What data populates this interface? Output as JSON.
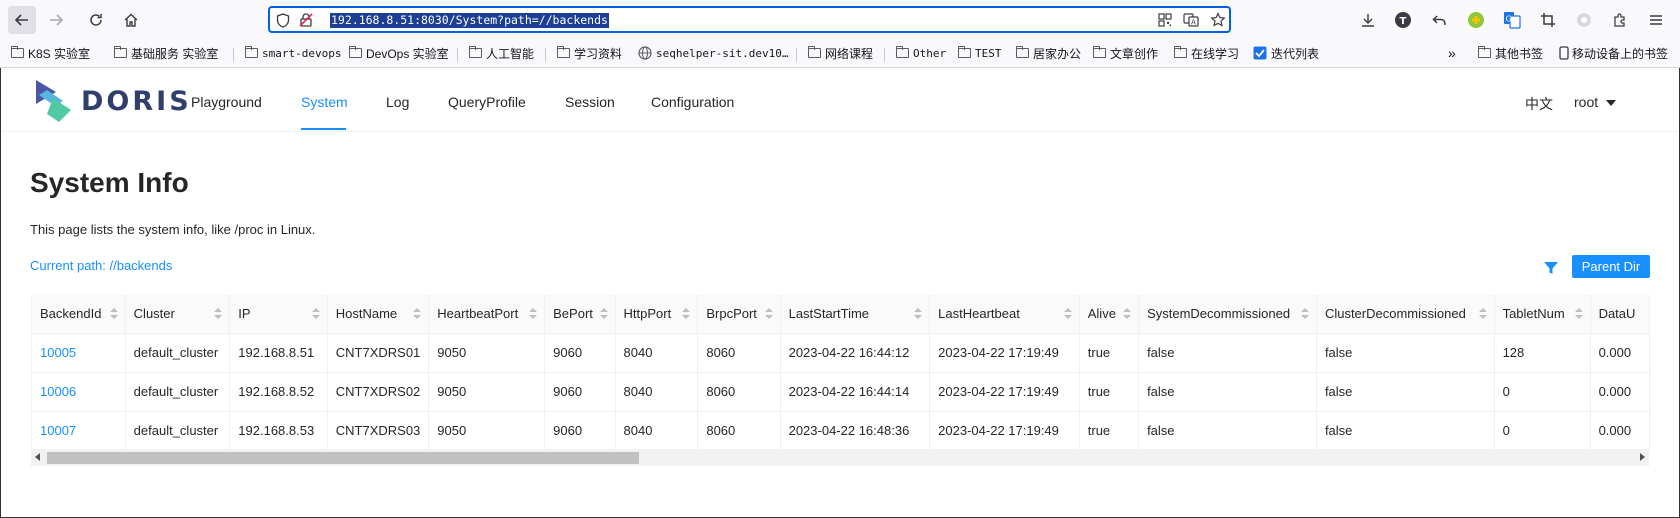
{
  "browser": {
    "url": "192.168.8.51:8030/System?path=//backends",
    "bookmarks": [
      "K8S 实验室",
      "基础服务 实验室",
      "smart-devops",
      "DevOps 实验室",
      "人工智能",
      "学习资料",
      "seqhelper-sit.dev10…",
      "网络课程",
      "Other",
      "TEST",
      "居家办公",
      "文章创作",
      "在线学习",
      "迭代列表"
    ],
    "other_bookmarks": "其他书签",
    "mobile_bookmarks": "移动设备上的书签"
  },
  "app": {
    "logo_text": "DORIS",
    "menu": [
      "Playground",
      "System",
      "Log",
      "QueryProfile",
      "Session",
      "Configuration"
    ],
    "active_menu": "System",
    "language": "中文",
    "user": "root"
  },
  "page": {
    "title": "System Info",
    "description": "This page lists the system info, like /proc in Linux.",
    "current_path": "Current path: //backends",
    "parent_dir_label": "Parent Dir"
  },
  "table": {
    "columns": [
      "BackendId",
      "Cluster",
      "IP",
      "HostName",
      "HeartbeatPort",
      "BePort",
      "HttpPort",
      "BrpcPort",
      "LastStartTime",
      "LastHeartbeat",
      "Alive",
      "SystemDecommissioned",
      "ClusterDecommissioned",
      "TabletNum",
      "DataU"
    ],
    "rows": [
      [
        "10005",
        "default_cluster",
        "192.168.8.51",
        "CNT7XDRS01",
        "9050",
        "9060",
        "8040",
        "8060",
        "2023-04-22 16:44:12",
        "2023-04-22 17:19:49",
        "true",
        "false",
        "false",
        "128",
        "0.000"
      ],
      [
        "10006",
        "default_cluster",
        "192.168.8.52",
        "CNT7XDRS02",
        "9050",
        "9060",
        "8040",
        "8060",
        "2023-04-22 16:44:14",
        "2023-04-22 17:19:49",
        "true",
        "false",
        "false",
        "0",
        "0.000"
      ],
      [
        "10007",
        "default_cluster",
        "192.168.8.53",
        "CNT7XDRS03",
        "9050",
        "9060",
        "8040",
        "8060",
        "2023-04-22 16:48:36",
        "2023-04-22 17:19:49",
        "true",
        "false",
        "false",
        "0",
        "0.000"
      ]
    ]
  },
  "colors": {
    "accent": "#1890ff",
    "logo": "#2f3e6b",
    "url_highlight": "#1c3f93"
  }
}
